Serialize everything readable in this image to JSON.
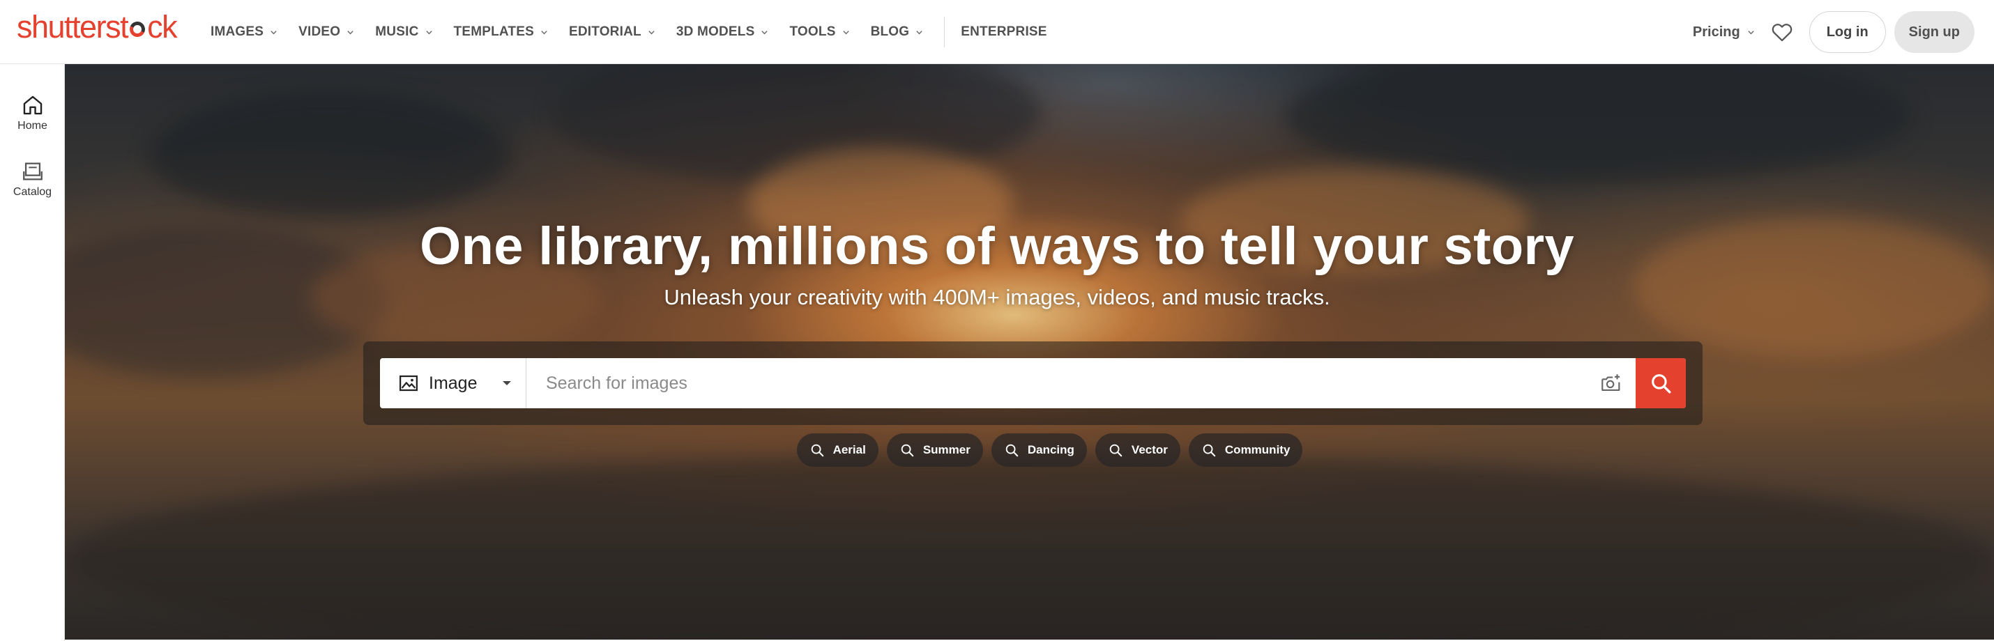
{
  "brand": {
    "name_part1": "shutterst",
    "name_part2": "ck",
    "accent": "#e5412f"
  },
  "nav": {
    "items": [
      {
        "label": "IMAGES",
        "icon": "chevron-down-icon"
      },
      {
        "label": "VIDEO",
        "icon": "chevron-down-icon"
      },
      {
        "label": "MUSIC",
        "icon": "chevron-down-icon"
      },
      {
        "label": "TEMPLATES",
        "icon": "chevron-down-icon"
      },
      {
        "label": "EDITORIAL",
        "icon": "chevron-down-icon"
      },
      {
        "label": "3D MODELS",
        "icon": "chevron-down-icon"
      },
      {
        "label": "TOOLS",
        "icon": "chevron-down-icon"
      },
      {
        "label": "BLOG",
        "icon": "chevron-down-icon"
      }
    ],
    "enterprise": "ENTERPRISE"
  },
  "right_nav": {
    "pricing": "Pricing",
    "favorites_icon": "heart-icon",
    "login": "Log in",
    "signup": "Sign up"
  },
  "rail": {
    "items": [
      {
        "label": "Home",
        "icon": "home-icon"
      },
      {
        "label": "Catalog",
        "icon": "catalog-icon"
      }
    ]
  },
  "hero": {
    "title": "One library, millions of ways to tell your story",
    "subtitle": "Unleash your creativity with 400M+ images, videos, and music tracks."
  },
  "search": {
    "type_label": "Image",
    "placeholder": "Search for images",
    "value": ""
  },
  "chips": [
    {
      "label": "Aerial"
    },
    {
      "label": "Summer"
    },
    {
      "label": "Dancing"
    },
    {
      "label": "Vector"
    },
    {
      "label": "Community"
    }
  ]
}
